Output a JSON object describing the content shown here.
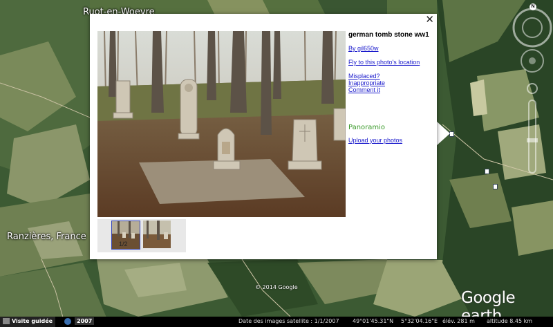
{
  "map": {
    "labels": {
      "town_top": "Ruot-en-Woevre",
      "town_left": "Ranzières, France"
    },
    "copyright": "© 2014 Google",
    "logo_text": "Google earth"
  },
  "popup": {
    "title": "german tomb stone ww1",
    "author_link": "By gil650w",
    "fly_link": "Fly to this photo's location",
    "misplaced_link": "Misplaced?",
    "inappropriate_link": "Inappropriate",
    "comment_link": "Comment it",
    "brand": "Panoramio",
    "upload_link": "Upload your photos",
    "close_glyph": "✕",
    "thumb_counter": "1/2"
  },
  "statusbar": {
    "tour_label": "Visite guidée",
    "year_badge": "2007",
    "imagery_date": "Date des images satellite : 1/1/2007",
    "lat": "49°01'45.31\"N",
    "lon": "5°32'04.16\"E",
    "elev": "élév.  281 m",
    "altitude": "altitude   8.45 km"
  },
  "nav": {
    "compass_letter": "N"
  },
  "colors": {
    "link": "#1a1acc",
    "panoramio_green": "#3a9a2a",
    "panoramio_blue": "#2a6fd6"
  }
}
